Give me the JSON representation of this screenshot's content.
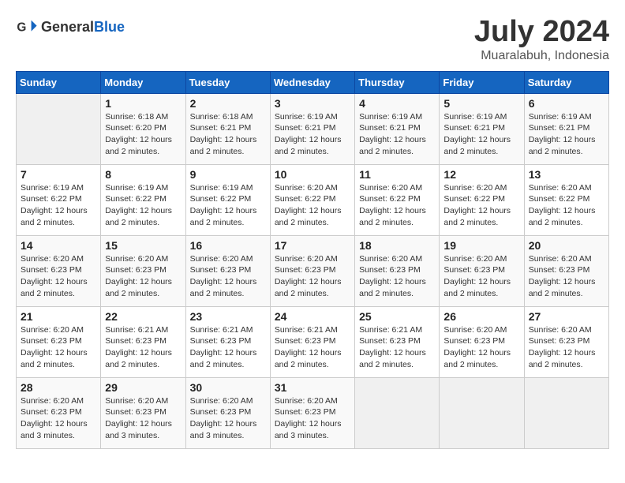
{
  "header": {
    "logo_general": "General",
    "logo_blue": "Blue",
    "month_title": "July 2024",
    "location": "Muaralabuh, Indonesia"
  },
  "days_of_week": [
    "Sunday",
    "Monday",
    "Tuesday",
    "Wednesday",
    "Thursday",
    "Friday",
    "Saturday"
  ],
  "weeks": [
    [
      {
        "day": "",
        "info": ""
      },
      {
        "day": "1",
        "info": "Sunrise: 6:18 AM\nSunset: 6:20 PM\nDaylight: 12 hours\nand 2 minutes."
      },
      {
        "day": "2",
        "info": "Sunrise: 6:18 AM\nSunset: 6:21 PM\nDaylight: 12 hours\nand 2 minutes."
      },
      {
        "day": "3",
        "info": "Sunrise: 6:19 AM\nSunset: 6:21 PM\nDaylight: 12 hours\nand 2 minutes."
      },
      {
        "day": "4",
        "info": "Sunrise: 6:19 AM\nSunset: 6:21 PM\nDaylight: 12 hours\nand 2 minutes."
      },
      {
        "day": "5",
        "info": "Sunrise: 6:19 AM\nSunset: 6:21 PM\nDaylight: 12 hours\nand 2 minutes."
      },
      {
        "day": "6",
        "info": "Sunrise: 6:19 AM\nSunset: 6:21 PM\nDaylight: 12 hours\nand 2 minutes."
      }
    ],
    [
      {
        "day": "7",
        "info": "Sunrise: 6:19 AM\nSunset: 6:22 PM\nDaylight: 12 hours\nand 2 minutes."
      },
      {
        "day": "8",
        "info": "Sunrise: 6:19 AM\nSunset: 6:22 PM\nDaylight: 12 hours\nand 2 minutes."
      },
      {
        "day": "9",
        "info": "Sunrise: 6:19 AM\nSunset: 6:22 PM\nDaylight: 12 hours\nand 2 minutes."
      },
      {
        "day": "10",
        "info": "Sunrise: 6:20 AM\nSunset: 6:22 PM\nDaylight: 12 hours\nand 2 minutes."
      },
      {
        "day": "11",
        "info": "Sunrise: 6:20 AM\nSunset: 6:22 PM\nDaylight: 12 hours\nand 2 minutes."
      },
      {
        "day": "12",
        "info": "Sunrise: 6:20 AM\nSunset: 6:22 PM\nDaylight: 12 hours\nand 2 minutes."
      },
      {
        "day": "13",
        "info": "Sunrise: 6:20 AM\nSunset: 6:22 PM\nDaylight: 12 hours\nand 2 minutes."
      }
    ],
    [
      {
        "day": "14",
        "info": "Sunrise: 6:20 AM\nSunset: 6:23 PM\nDaylight: 12 hours\nand 2 minutes."
      },
      {
        "day": "15",
        "info": "Sunrise: 6:20 AM\nSunset: 6:23 PM\nDaylight: 12 hours\nand 2 minutes."
      },
      {
        "day": "16",
        "info": "Sunrise: 6:20 AM\nSunset: 6:23 PM\nDaylight: 12 hours\nand 2 minutes."
      },
      {
        "day": "17",
        "info": "Sunrise: 6:20 AM\nSunset: 6:23 PM\nDaylight: 12 hours\nand 2 minutes."
      },
      {
        "day": "18",
        "info": "Sunrise: 6:20 AM\nSunset: 6:23 PM\nDaylight: 12 hours\nand 2 minutes."
      },
      {
        "day": "19",
        "info": "Sunrise: 6:20 AM\nSunset: 6:23 PM\nDaylight: 12 hours\nand 2 minutes."
      },
      {
        "day": "20",
        "info": "Sunrise: 6:20 AM\nSunset: 6:23 PM\nDaylight: 12 hours\nand 2 minutes."
      }
    ],
    [
      {
        "day": "21",
        "info": "Sunrise: 6:20 AM\nSunset: 6:23 PM\nDaylight: 12 hours\nand 2 minutes."
      },
      {
        "day": "22",
        "info": "Sunrise: 6:21 AM\nSunset: 6:23 PM\nDaylight: 12 hours\nand 2 minutes."
      },
      {
        "day": "23",
        "info": "Sunrise: 6:21 AM\nSunset: 6:23 PM\nDaylight: 12 hours\nand 2 minutes."
      },
      {
        "day": "24",
        "info": "Sunrise: 6:21 AM\nSunset: 6:23 PM\nDaylight: 12 hours\nand 2 minutes."
      },
      {
        "day": "25",
        "info": "Sunrise: 6:21 AM\nSunset: 6:23 PM\nDaylight: 12 hours\nand 2 minutes."
      },
      {
        "day": "26",
        "info": "Sunrise: 6:20 AM\nSunset: 6:23 PM\nDaylight: 12 hours\nand 2 minutes."
      },
      {
        "day": "27",
        "info": "Sunrise: 6:20 AM\nSunset: 6:23 PM\nDaylight: 12 hours\nand 2 minutes."
      }
    ],
    [
      {
        "day": "28",
        "info": "Sunrise: 6:20 AM\nSunset: 6:23 PM\nDaylight: 12 hours\nand 3 minutes."
      },
      {
        "day": "29",
        "info": "Sunrise: 6:20 AM\nSunset: 6:23 PM\nDaylight: 12 hours\nand 3 minutes."
      },
      {
        "day": "30",
        "info": "Sunrise: 6:20 AM\nSunset: 6:23 PM\nDaylight: 12 hours\nand 3 minutes."
      },
      {
        "day": "31",
        "info": "Sunrise: 6:20 AM\nSunset: 6:23 PM\nDaylight: 12 hours\nand 3 minutes."
      },
      {
        "day": "",
        "info": ""
      },
      {
        "day": "",
        "info": ""
      },
      {
        "day": "",
        "info": ""
      }
    ]
  ]
}
